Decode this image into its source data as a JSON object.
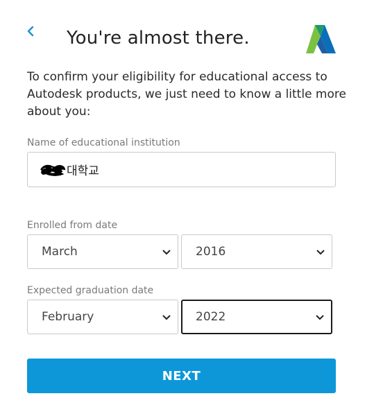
{
  "header": {
    "title": "You're almost there.",
    "back_icon": "chevron-left-icon",
    "logo_icon": "autodesk-logo-icon"
  },
  "intro_text": "To confirm your eligibility for educational access to Autodesk products, we just need to know a little more about you:",
  "institution": {
    "label": "Name of educational institution",
    "value": "대학교"
  },
  "enrolled": {
    "label": "Enrolled from date",
    "month": "March",
    "year": "2016"
  },
  "graduation": {
    "label": "Expected graduation date",
    "month": "February",
    "year": "2022"
  },
  "next_label": "NEXT",
  "colors": {
    "accent": "#0d97d9",
    "back_chevron": "#1a8fd1"
  }
}
